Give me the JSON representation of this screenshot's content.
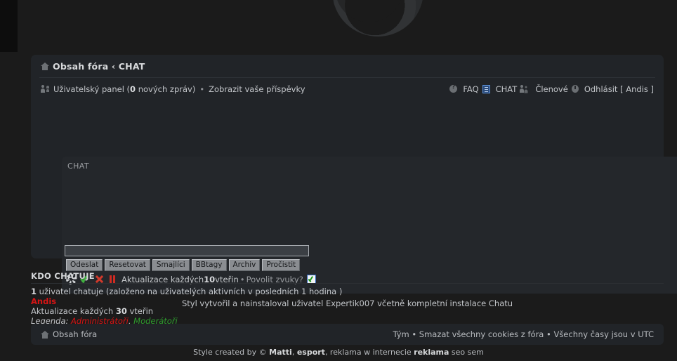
{
  "header": {
    "logo_icon": "swirl-logo"
  },
  "breadcrumb": {
    "home_icon": "home-icon",
    "text": "Obsah fóra ‹ CHAT"
  },
  "navlinks": {
    "user_icon": "user-panel-icon",
    "ucp_label": "Uživatelský panel (",
    "ucp_count": "0",
    "ucp_label_end": " nových zpráv)",
    "separator": "•",
    "own_posts": "Zobrazit vaše příspěvky",
    "faq_icon": "faq-icon",
    "faq": "FAQ",
    "chat_icon": "chat-icon",
    "chat": "CHAT",
    "members_icon": "members-icon",
    "members": "Členové",
    "logout_icon": "power-icon",
    "logout": "Odhlásit [ Andis ]"
  },
  "chat": {
    "title": "CHAT",
    "input_value": "",
    "input_placeholder": "",
    "buttons": [
      "Odeslat",
      "Resetovat",
      "Smajlíci",
      "BBtagy",
      "Archiv",
      "Pročistit"
    ],
    "status": {
      "gear_icon": "gear-icon",
      "check_icon": "green-check-icon",
      "x_icon": "red-x-icon",
      "pause_icon": "pause-icon",
      "refresh_prefix": "Aktualizace každých ",
      "refresh_seconds": "10",
      "refresh_suffix": " vteřin",
      "separator": "•",
      "sound_label": "Povolit zvuky?",
      "sound_checked": true
    },
    "install_note": "Styl vytvořil a nainstaloval uživatel Expertik007 včetně kompletní instalace Chatu"
  },
  "who_chatting": {
    "heading": "KDO CHATUJE",
    "count": "1",
    "count_text": " uživatel chatuje  (založeno na uživatelých aktivních v posledních 1 hodina )",
    "users": "Andis",
    "refresh_prefix": "Aktualizace každých ",
    "refresh_seconds": "30",
    "refresh_suffix": " vteřin",
    "legend_label": "Legenda: ",
    "legend_admin": "Administrátoři",
    "legend_comma": ", ",
    "legend_mod": "Moderátoři"
  },
  "bottom_bar": {
    "home_icon": "home-icon",
    "home_label": "Obsah fóra",
    "right_text": "Tým • Smazat všechny cookies z fóra • Všechny časy jsou v UTC"
  },
  "copyright": {
    "prefix": "Style created by © ",
    "author": "Matti",
    "mid1": ", ",
    "brand": "esport",
    "mid2": ", reklama w internecie ",
    "ad": "reklama",
    "suffix": " seo sem"
  },
  "colors": {
    "page_bg": "#1b1b1b",
    "panel_bg": "#212428",
    "chat_bg": "#24272b",
    "text": "#c3c6ca",
    "accent_red": "#d71414",
    "accent_green": "#2e9b2e",
    "chat_icon_blue": "#5a8fd6"
  }
}
